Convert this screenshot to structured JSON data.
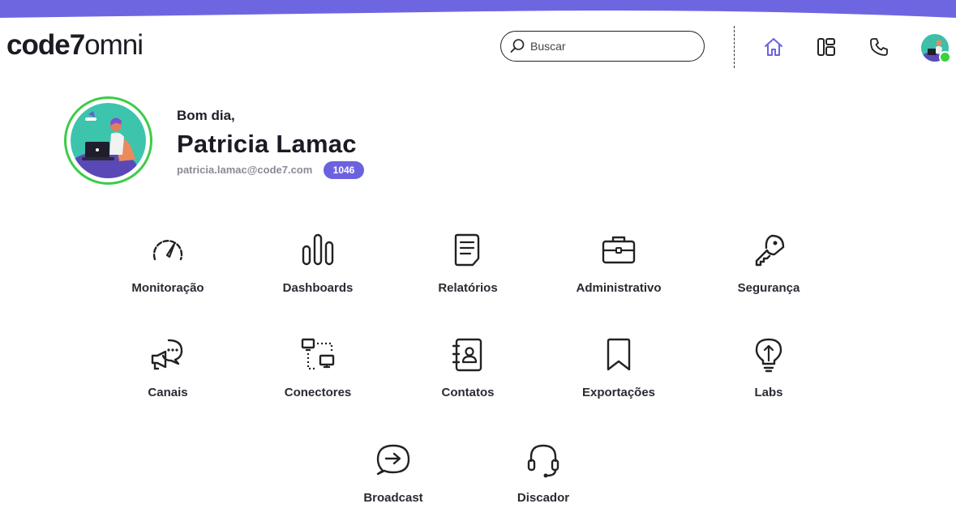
{
  "brand": {
    "logo_bold": "code7",
    "logo_light": "omni",
    "accent": "#6c62e0",
    "online": "#36d33f"
  },
  "search": {
    "placeholder": "Buscar"
  },
  "header_icons": [
    "home-icon",
    "layout-icon",
    "phone-icon"
  ],
  "user": {
    "greeting": "Bom dia,",
    "name": "Patricia Lamac",
    "email": "patricia.lamac@code7.com",
    "badge": "1046"
  },
  "modules": [
    {
      "label": "Monitoração",
      "icon": "speedometer-icon"
    },
    {
      "label": "Dashboards",
      "icon": "bar-chart-icon"
    },
    {
      "label": "Relatórios",
      "icon": "document-icon"
    },
    {
      "label": "Administrativo",
      "icon": "briefcase-icon"
    },
    {
      "label": "Segurança",
      "icon": "key-icon"
    },
    {
      "label": "Canais",
      "icon": "megaphone-icon"
    },
    {
      "label": "Conectores",
      "icon": "network-icon"
    },
    {
      "label": "Contatos",
      "icon": "contacts-book-icon"
    },
    {
      "label": "Exportações",
      "icon": "bookmark-icon"
    },
    {
      "label": "Labs",
      "icon": "lightbulb-icon"
    },
    {
      "label": "Broadcast",
      "icon": "chat-arrow-icon"
    },
    {
      "label": "Discador",
      "icon": "headset-icon"
    }
  ]
}
